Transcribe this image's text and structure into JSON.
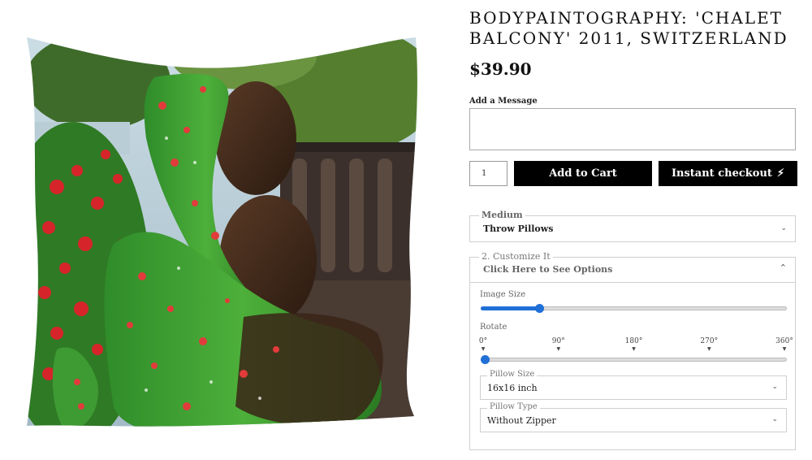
{
  "product": {
    "title": "BODYPAINTOGRAPHY: 'CHALET BALCONY' 2011, SWITZERLAND",
    "price": "$39.90"
  },
  "message": {
    "label": "Add a Message",
    "value": ""
  },
  "quantity": "1",
  "buttons": {
    "add_to_cart": "Add to Cart",
    "instant_checkout": "Instant checkout",
    "instant_icon": "lightning-bolt-icon"
  },
  "medium": {
    "legend": "Medium",
    "selected": "Throw Pillows"
  },
  "customize": {
    "legend": "2. Customize It",
    "toggle_text": "Click Here to See Options",
    "image_size": {
      "label": "Image Size",
      "value_fraction": 0.19
    },
    "rotate": {
      "label": "Rotate",
      "ticks": [
        "0°",
        "90°",
        "180°",
        "270°",
        "360°"
      ],
      "value_deg": 0
    },
    "pillow_size": {
      "legend": "Pillow Size",
      "selected": "16x16 inch"
    },
    "pillow_type": {
      "legend": "Pillow Type",
      "selected": "Without Zipper"
    }
  },
  "colors": {
    "accent": "#1f6fd6",
    "button_bg": "#000000"
  }
}
